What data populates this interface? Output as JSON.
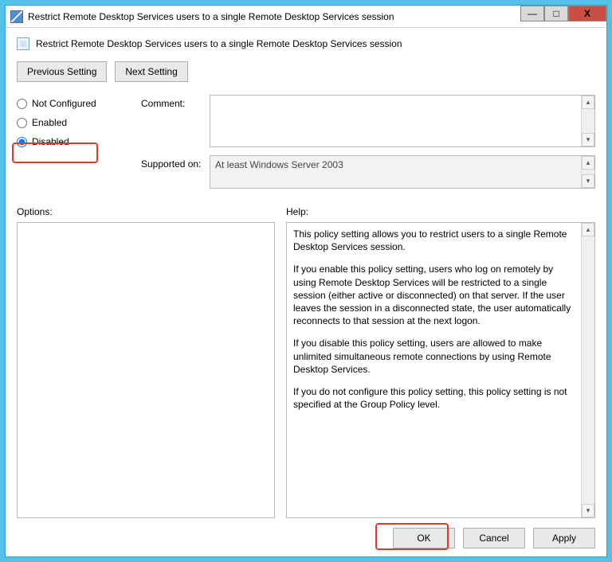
{
  "window": {
    "title": "Restrict Remote Desktop Services users to a single Remote Desktop Services session"
  },
  "heading": "Restrict Remote Desktop Services users to a single Remote Desktop Services session",
  "nav": {
    "prev": "Previous Setting",
    "next": "Next Setting"
  },
  "radios": {
    "not_configured": "Not Configured",
    "enabled": "Enabled",
    "disabled": "Disabled",
    "selected": "disabled"
  },
  "labels": {
    "comment": "Comment:",
    "supported": "Supported on:",
    "options": "Options:",
    "help": "Help:"
  },
  "comment_value": "",
  "supported_text": "At least Windows Server 2003",
  "help": {
    "p1": "This policy setting allows you to restrict users to a single Remote Desktop Services session.",
    "p2": "If you enable this policy setting, users who log on remotely by using Remote Desktop Services will be restricted to a single session (either active or disconnected) on that server. If the user leaves the session in a disconnected state, the user automatically reconnects to that session at the next logon.",
    "p3": "If you disable this policy setting, users are allowed to make unlimited simultaneous remote connections by using Remote Desktop Services.",
    "p4": "If you do not configure this policy setting,  this policy setting is not specified at the Group Policy level."
  },
  "footer": {
    "ok": "OK",
    "cancel": "Cancel",
    "apply": "Apply"
  },
  "glyphs": {
    "up": "▴",
    "down": "▾",
    "min": "—",
    "max": "□",
    "close": "X"
  }
}
